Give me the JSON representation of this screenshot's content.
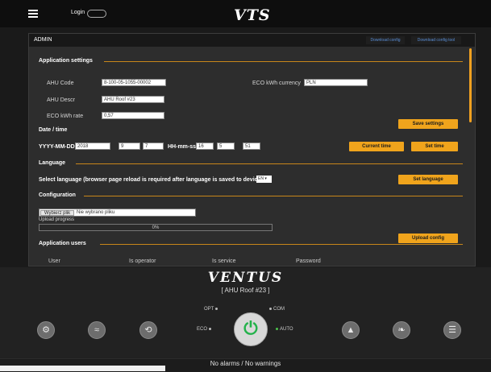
{
  "header": {
    "login_label": "Login",
    "logo_text": "VTS"
  },
  "panel": {
    "title": "ADMIN",
    "tabs": [
      "Download config",
      "Download config tool"
    ]
  },
  "app_settings": {
    "title": "Application settings",
    "ahu_code_label": "AHU Code",
    "ahu_code_value": "8-100-05-1055-00002",
    "ahu_descr_label": "AHU Descr",
    "ahu_descr_value": "AHU Roof #23",
    "eco_rate_label": "ECO kWh rate",
    "eco_rate_value": "0,57",
    "eco_currency_label": "ECO kWh currency",
    "eco_currency_value": "PLN",
    "save_label": "Save settings"
  },
  "datetime": {
    "title": "Date / time",
    "date_label": "YYYY-MM-DD",
    "year": "2018",
    "month": "9",
    "day": "7",
    "time_label": "HH-mm-ss",
    "hour": "16",
    "minute": "5",
    "second": "51",
    "current_time_label": "Current time",
    "set_time_label": "Set time"
  },
  "language": {
    "title": "Language",
    "prompt": "Select language (browser page reload is required after language is saved to device)",
    "selected": "EN ▾",
    "set_label": "Set language"
  },
  "configuration": {
    "title": "Configuration",
    "file_button": "Wybierz plik",
    "file_status": "Nie wybrano pliku",
    "progress_label": "Upload progress",
    "progress_text": "0%",
    "upload_label": "Upload config"
  },
  "users": {
    "title": "Application users",
    "columns": [
      "User",
      "Is operator",
      "Is service",
      "Password"
    ]
  },
  "bottom": {
    "brand": "VENTUS",
    "unit": "[ AHU Roof #23 ]",
    "modes": {
      "opt": "OPT",
      "com": "COM",
      "eco": "ECO",
      "auto": "AUTO"
    },
    "status": "No alarms / No warnings"
  }
}
